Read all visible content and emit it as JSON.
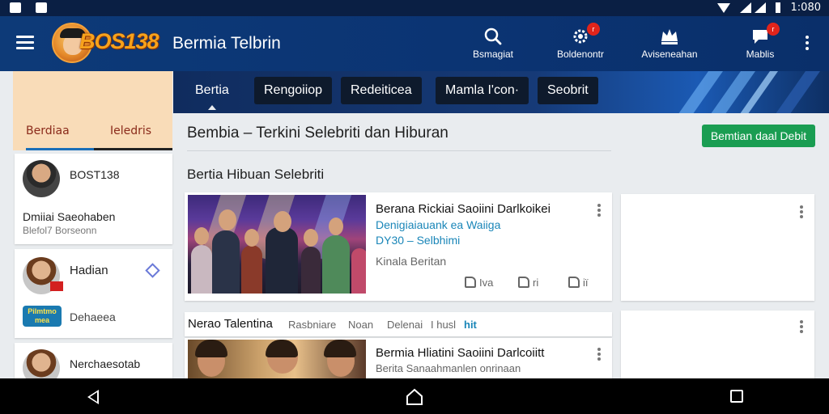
{
  "status_bar": {
    "time": "1:080"
  },
  "app_bar": {
    "logo_text": "BOS138",
    "title": "Bermia Telbrin",
    "actions": [
      {
        "label": "Bsmagiat",
        "icon": "search-icon",
        "badge": ""
      },
      {
        "label": "Boldenontr",
        "icon": "settings-gear-icon",
        "badge": "r"
      },
      {
        "label": "Aviseneahan",
        "icon": "crown-icon",
        "badge": ""
      },
      {
        "label": "Mablis",
        "icon": "chat-icon",
        "badge": "r"
      }
    ]
  },
  "tabs": [
    {
      "label": "Bertia"
    },
    {
      "label": "Rengoiiop"
    },
    {
      "label": "Redeiticea"
    },
    {
      "label": "Mamla I'con·"
    },
    {
      "label": "Seobrit"
    }
  ],
  "sidebar": {
    "header_tabs": [
      "Berdiaa",
      "Ieledris"
    ],
    "cards": [
      {
        "name": "BOST138",
        "line1": "Dmiiai Saeohaben",
        "line2": "Blefol7 Borseonn"
      },
      {
        "name": "Hadian",
        "line1": "Dehaeea",
        "logo_text": "Pilmtmo\nmea"
      },
      {
        "name": "Nerchaesotab"
      }
    ]
  },
  "main": {
    "page_title": "Bembia – Terkini Selebriti dan Hiburan",
    "cta_label": "Bemtian daal Debit",
    "section_title": "Bertia Hibuan Selebriti",
    "articles": [
      {
        "title": "Berana Rickiai Saoiini Darlkoikei",
        "subtitle_link": "Denigiaiauank ea Waiiga",
        "subtitle_link2": "DY30 – Selbhimi",
        "source": "Kinala Beritan",
        "reactions": [
          "Iva",
          "ri",
          "iï"
        ]
      },
      {
        "title": "Bermia Hliatini Saoiini Darlcoiitt",
        "source": "Berita Sanaahmanlen onrinaan"
      }
    ],
    "strip": {
      "lead": "Nerao Talentina",
      "items": [
        "Rasbniare",
        "Noan",
        "Delenai",
        "I husl"
      ],
      "highlight": "hit"
    }
  },
  "colors": {
    "app_bar": "#0b3473",
    "cta": "#1a9d52",
    "accent_link": "#1a86b8",
    "logo": "#f7a21b"
  }
}
